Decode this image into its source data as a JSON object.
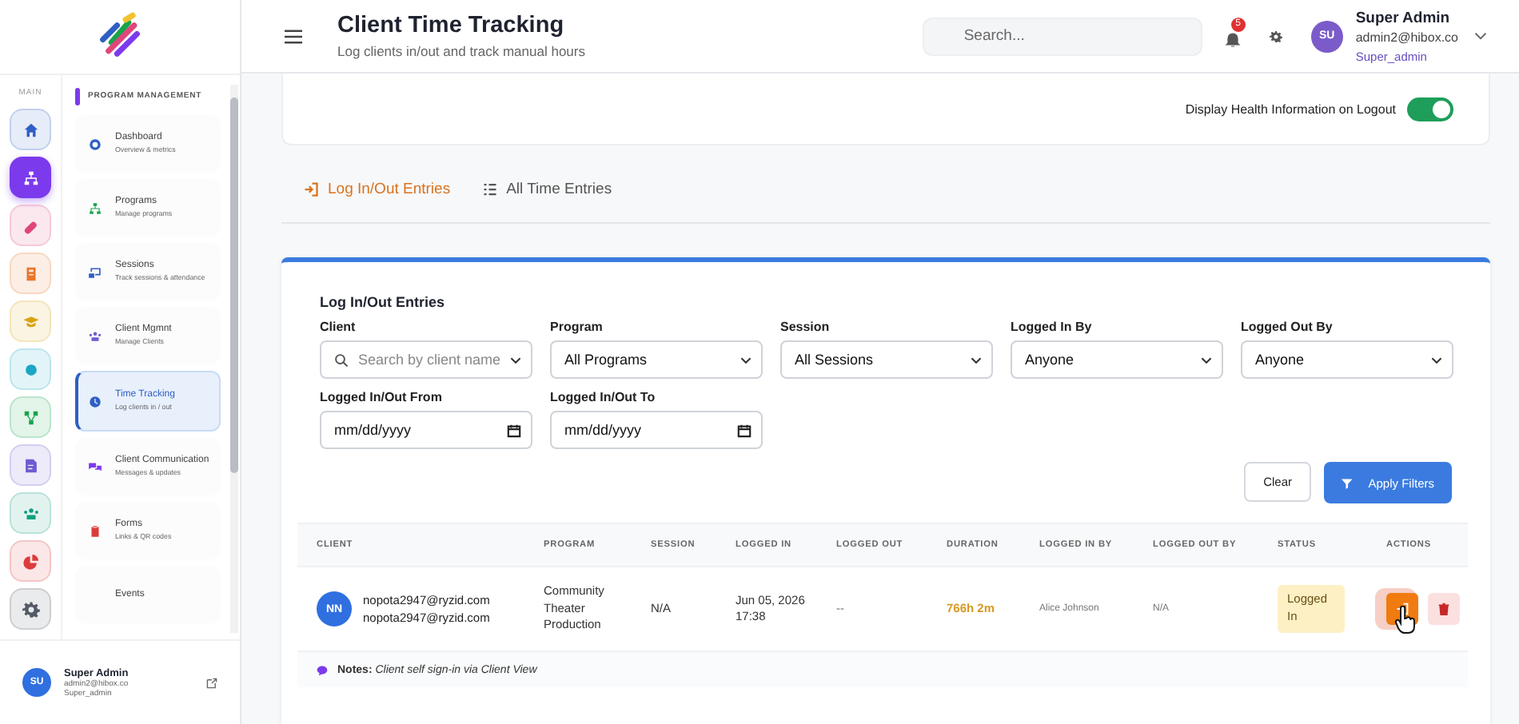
{
  "sidebar": {
    "section_label": "MAIN",
    "rail": [
      {
        "color": "#2f5fc4",
        "selected": false
      },
      {
        "color": "#7c3aed",
        "selected": true
      },
      {
        "color": "#e0457b",
        "selected": false
      },
      {
        "color": "#e8772a",
        "selected": false
      },
      {
        "color": "#d9a316",
        "selected": false
      },
      {
        "color": "#1aa6c4",
        "selected": false
      },
      {
        "color": "#16a34a",
        "selected": false
      },
      {
        "color": "#6d5bd0",
        "selected": false
      },
      {
        "color": "#0f9f7f",
        "selected": false
      },
      {
        "color": "#dc3b3b",
        "selected": false
      },
      {
        "color": "#555b66",
        "selected": false
      }
    ],
    "group_title": "PROGRAM MANAGEMENT",
    "items": [
      {
        "label": "Dashboard",
        "description": "Overview & metrics",
        "selected": false
      },
      {
        "label": "Programs",
        "description": "Manage programs",
        "selected": false
      },
      {
        "label": "Sessions",
        "description": "Track sessions & attendance",
        "selected": false
      },
      {
        "label": "Client Mgmnt",
        "description": "Manage Clients",
        "selected": false
      },
      {
        "label": "Time Tracking",
        "description": "Log clients in / out",
        "selected": true
      },
      {
        "label": "Client Communication",
        "description": "Messages & updates",
        "selected": false
      },
      {
        "label": "Forms",
        "description": "Links & QR codes",
        "selected": false
      },
      {
        "label": "Events",
        "selected": false
      }
    ],
    "user": {
      "avatar": "SU",
      "name": "Super Admin",
      "email": "admin2@hibox.co",
      "role": "Super_admin"
    }
  },
  "header": {
    "title": "Client Time Tracking",
    "subtitle": "Log clients in/out and track manual hours",
    "search": {
      "placeholder": "Search..."
    },
    "notification_count": "5",
    "user": {
      "avatar": "SU",
      "name": "Super Admin",
      "email": "admin2@hibox.co",
      "role": "Super_admin"
    }
  },
  "health_toggle": {
    "label": "Display Health Information on Logout",
    "on": true
  },
  "tabs": [
    {
      "label": "Log In/Out Entries",
      "selected": true
    },
    {
      "label": "All Time Entries",
      "selected": false
    }
  ],
  "filters": {
    "title": "Log In/Out Entries",
    "fields": [
      {
        "kind": "search",
        "label": "Client",
        "placeholder": "Search by client name"
      },
      {
        "kind": "select",
        "label": "Program",
        "value": "All Programs"
      },
      {
        "kind": "select",
        "label": "Session",
        "value": "All Sessions"
      },
      {
        "kind": "select",
        "label": "Logged In By",
        "value": "Anyone"
      },
      {
        "kind": "select",
        "label": "Logged Out By",
        "value": "Anyone"
      },
      {
        "kind": "date",
        "label": "Logged In/Out From",
        "value": "mm/dd/yyyy"
      },
      {
        "kind": "date",
        "label": "Logged In/Out To",
        "value": "mm/dd/yyyy"
      }
    ],
    "clear_button": "Clear",
    "apply_button": "Apply Filters"
  },
  "table": {
    "columns": [
      "CLIENT",
      "PROGRAM",
      "SESSION",
      "LOGGED IN",
      "LOGGED OUT",
      "DURATION",
      "LOGGED IN BY",
      "LOGGED OUT BY",
      "STATUS",
      "ACTIONS"
    ],
    "rows": [
      {
        "avatar": "NN",
        "client_lines": [
          "nopota2947@ryzid.com",
          "nopota2947@ryzid.com"
        ],
        "program": "Community Theater Production",
        "session": "N/A",
        "logged_in": "Jun 05, 2026 17:38",
        "logged_out": "--",
        "duration": "766h 2m",
        "logged_in_by": "Alice Johnson",
        "logged_out_by": "N/A",
        "status": "Logged In",
        "notes_label": "Notes:",
        "notes": "Client self sign-in via Client View"
      }
    ]
  }
}
